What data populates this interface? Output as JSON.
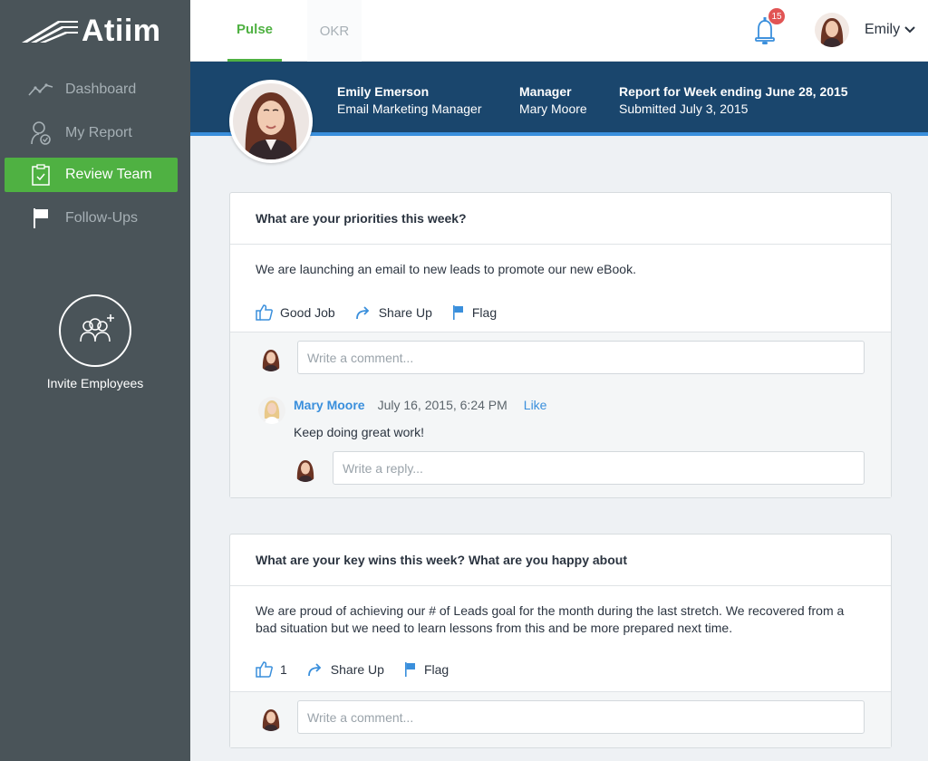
{
  "app": {
    "logo": "Atiim"
  },
  "sidebar": {
    "items": [
      {
        "label": "Dashboard",
        "icon": "chart-line-icon",
        "active": false
      },
      {
        "label": "My Report",
        "icon": "user-report-icon",
        "active": false
      },
      {
        "label": "Review Team",
        "icon": "clipboard-check-icon",
        "active": true
      },
      {
        "label": "Follow-Ups",
        "icon": "flag-icon",
        "active": false
      }
    ],
    "invite_label": "Invite Employees"
  },
  "topbar": {
    "tabs": [
      {
        "label": "Pulse",
        "active": true
      },
      {
        "label": "OKR",
        "active": false
      }
    ],
    "notifications": "15",
    "user": "Emily"
  },
  "report": {
    "employee_name": "Emily Emerson",
    "employee_title": "Email Marketing Manager",
    "manager_label": "Manager",
    "manager_name": "Mary Moore",
    "period": "Report for Week ending June 28, 2015",
    "submitted": "Submitted July 3, 2015"
  },
  "cards": [
    {
      "question": "What are your priorities this week?",
      "answer": "We are launching an email to new leads to promote our new eBook.",
      "good_job": "Good Job",
      "share_up": "Share Up",
      "flag": "Flag",
      "comment_placeholder": "Write a comment...",
      "comment": {
        "author": "Mary Moore",
        "date": "July 16, 2015, 6:24 PM",
        "like": "Like",
        "text": "Keep doing great work!",
        "reply_placeholder": "Write a reply..."
      }
    },
    {
      "question": "What are your key wins this week? What are you happy about",
      "answer": "We are proud of achieving our # of Leads goal for the month during the last stretch. We recovered from a bad situation but we need to learn lessons from this and be more prepared next time.",
      "likes": "1",
      "share_up": "Share Up",
      "flag": "Flag",
      "comment_placeholder": "Write a comment..."
    }
  ],
  "colors": {
    "sidebar": "#4a5459",
    "accent_green": "#4fb142",
    "header_blue": "#1a466d",
    "link_blue": "#3a8fdc"
  }
}
